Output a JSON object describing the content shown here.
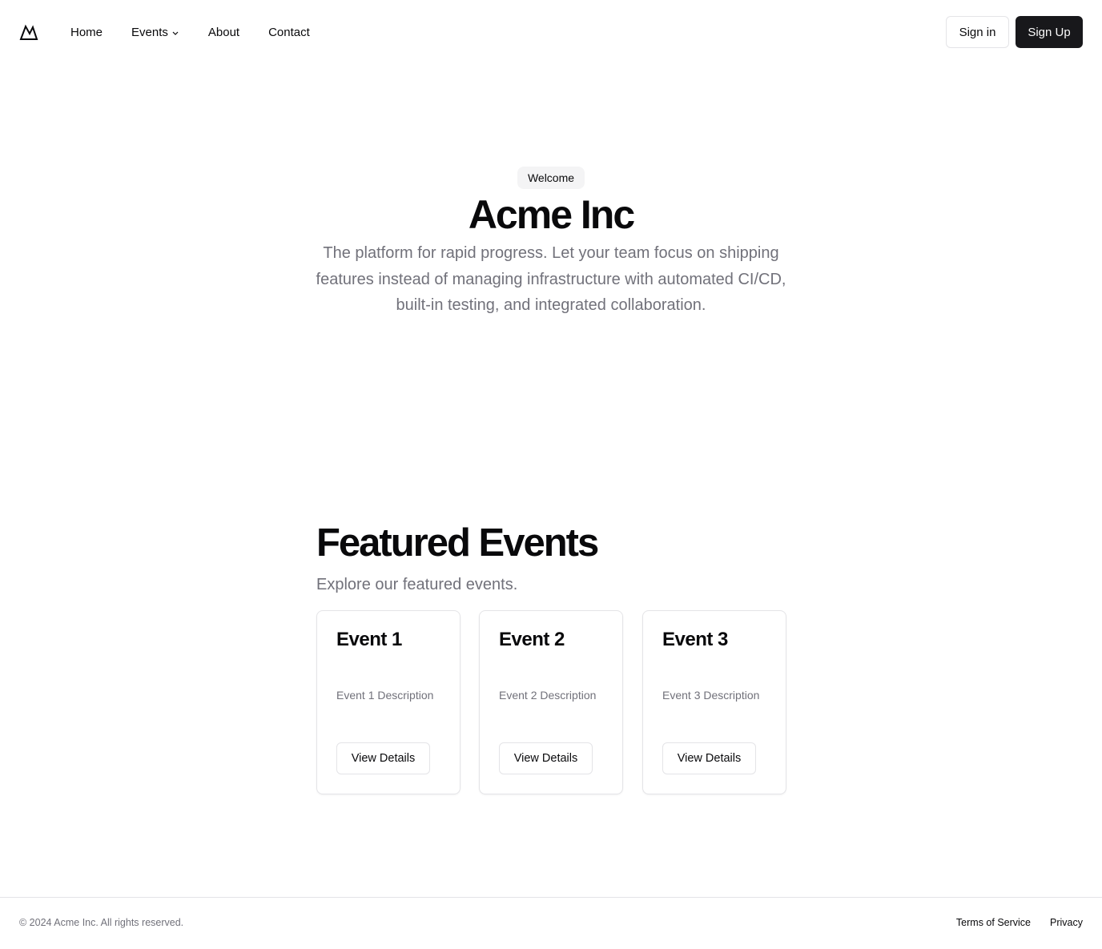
{
  "header": {
    "logo_icon": "mountain-icon",
    "nav": [
      {
        "label": "Home"
      },
      {
        "label": "Events",
        "icon": "chevron-down-icon"
      },
      {
        "label": "About"
      },
      {
        "label": "Contact"
      }
    ],
    "signin_label": "Sign in",
    "signup_label": "Sign Up"
  },
  "hero": {
    "badge": "Welcome",
    "title": "Acme Inc",
    "subtitle": "The platform for rapid progress. Let your team focus on shipping features instead of managing infrastructure with automated CI/CD, built-in testing, and integrated collaboration."
  },
  "featured": {
    "title": "Featured Events",
    "subtitle": "Explore our featured events.",
    "cards": [
      {
        "title": "Event 1",
        "description": "Event 1 Description",
        "button": "View Details"
      },
      {
        "title": "Event 2",
        "description": "Event 2 Description",
        "button": "View Details"
      },
      {
        "title": "Event 3",
        "description": "Event 3 Description",
        "button": "View Details"
      }
    ]
  },
  "footer": {
    "copyright": "© 2024 Acme Inc. All rights reserved.",
    "links": [
      "Terms of Service",
      "Privacy"
    ]
  },
  "colors": {
    "primary": "#18181b",
    "muted_text": "#71717a",
    "border": "#e4e4e7",
    "badge_bg": "#f4f4f5"
  }
}
